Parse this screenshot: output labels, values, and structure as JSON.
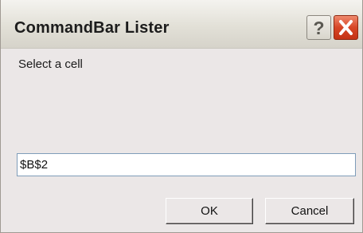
{
  "window": {
    "title": "CommandBar Lister"
  },
  "titlebar_buttons": {
    "help": "?",
    "close_icon": "close-x-icon"
  },
  "dialog": {
    "prompt": "Select a cell",
    "input_value": "$B$2",
    "ok_label": "OK",
    "cancel_label": "Cancel"
  },
  "colors": {
    "dialog_background": "#ebe7e7",
    "close_button": "#d74626",
    "input_border": "#7f9db9"
  }
}
